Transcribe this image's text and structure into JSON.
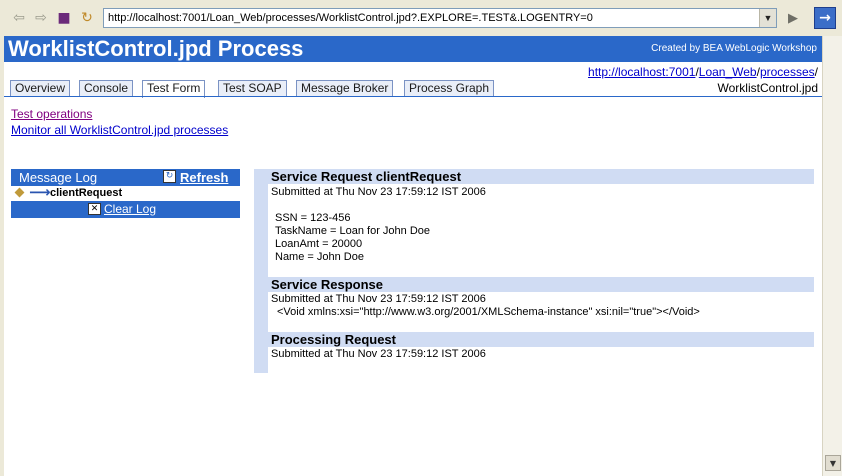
{
  "address": {
    "url": "http://localhost:7001/Loan_Web/processes/WorklistControl.jpd?.EXPLORE=.TEST&.LOGENTRY=0"
  },
  "header": {
    "title": "WorklistControl.jpd Process",
    "credit": "Created by BEA WebLogic Workshop"
  },
  "tabs": [
    "Overview",
    "Console",
    "Test Form",
    "Test SOAP",
    "Message Broker",
    "Process Graph"
  ],
  "url_block": {
    "host": "http://localhost:7001",
    "app": "Loan_Web",
    "folder": "processes",
    "slash": "/",
    "file": "WorklistControl.jpd"
  },
  "links": {
    "test_operations": "Test operations",
    "monitor_all": "Monitor all WorklistControl.jpd processes"
  },
  "message_log": {
    "title": "Message Log",
    "refresh": "Refresh",
    "entry": "clientRequest",
    "clear": "Clear Log"
  },
  "sections": {
    "request_title": "Service Request clientRequest",
    "request_submitted": "Submitted at Thu Nov 23 17:59:12 IST 2006",
    "params": [
      "SSN = 123-456",
      "TaskName = Loan for John Doe",
      "LoanAmt = 20000",
      "Name = John Doe"
    ],
    "response_title": "Service Response",
    "response_submitted": "Submitted at Thu Nov 23 17:59:12 IST 2006",
    "response_body": "<Void xmlns:xsi=\"http://www.w3.org/2001/XMLSchema-instance\" xsi:nil=\"true\"></Void>",
    "processing_title": "Processing Request",
    "processing_submitted": "Submitted at Thu Nov 23 17:59:12 IST 2006"
  },
  "icons": {
    "back": "back-arrow-icon",
    "forward": "forward-arrow-icon",
    "stop": "stop-icon",
    "refresh": "refresh-icon",
    "go": "go-arrow-icon",
    "navigate": "navigate-icon"
  },
  "colors": {
    "accent": "#2a68c9",
    "section_bg": "#d0dcf3",
    "link": "#0000cc",
    "visited": "#800080"
  }
}
